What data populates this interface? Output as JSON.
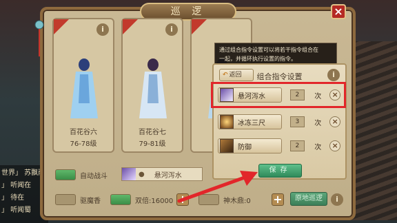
{
  "window": {
    "title": "巡 逻"
  },
  "cards": [
    {
      "name": "百花谷六",
      "level": "76-78级"
    },
    {
      "name": "百花谷七",
      "level": "79-81级"
    },
    {
      "name": "",
      "level": ""
    }
  ],
  "controls": {
    "auto_battle": "自动战斗",
    "skill_selected": "悬河泻水",
    "repel_incense": "驱魔香",
    "double_label": "双倍:16000",
    "shenmu": "神木鼎:0",
    "patrol_button": "原地巡逻"
  },
  "tooltip": {
    "text_line1": "通过组合指令设置可以将若干指令组合在",
    "text_line2": "一起，并循环执行设置的指令。"
  },
  "popup": {
    "back_label": "返回",
    "title": "组合指令设置",
    "commands": [
      {
        "skill": "悬河泻水",
        "count": "2",
        "unit": "次"
      },
      {
        "skill": "冰冻三尺",
        "count": "3",
        "unit": "次"
      },
      {
        "skill": "防御",
        "count": "2",
        "unit": "次"
      }
    ],
    "save_label": "保存"
  },
  "chat": [
    "世界」 苏飘雨",
    "」 听闻在",
    "」 待在",
    "」 听闻蜀"
  ],
  "colors": {
    "highlight": "#e2262a",
    "accent_green": "#3b7f58",
    "panel": "#c9b894"
  }
}
